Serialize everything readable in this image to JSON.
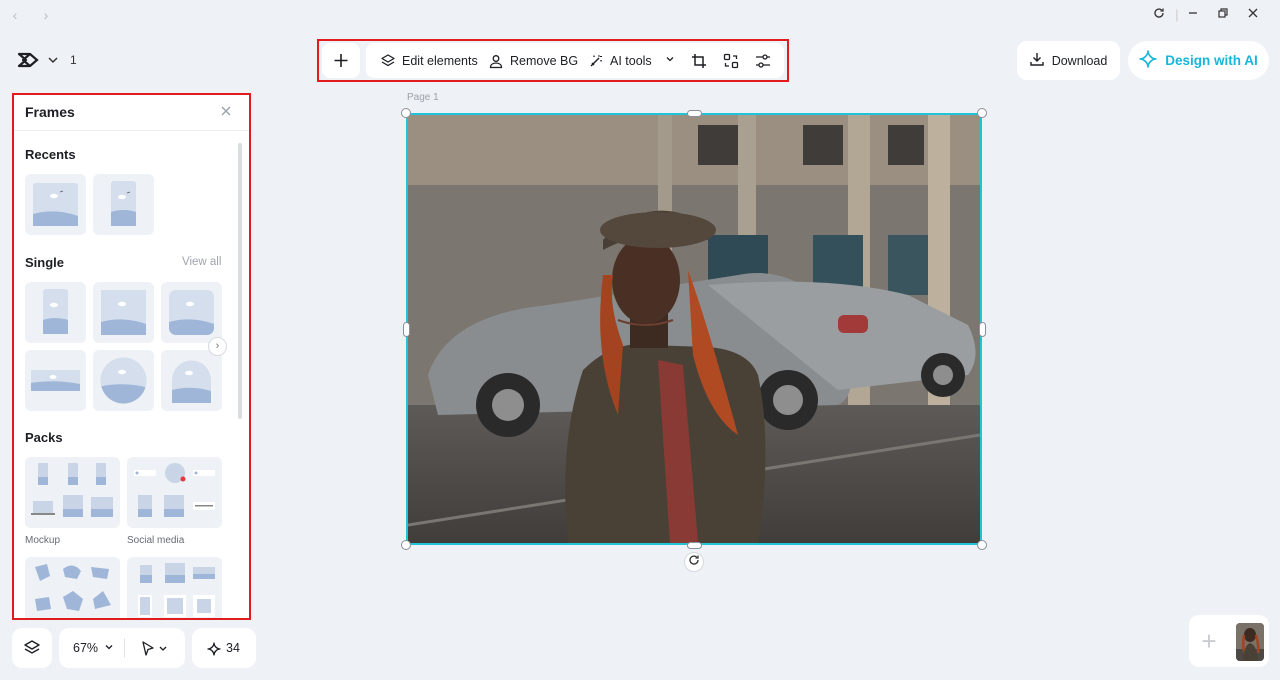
{
  "app": {
    "project_count": "1"
  },
  "toolbar": {
    "add_label": "+",
    "edit_elements": "Edit elements",
    "remove_bg": "Remove BG",
    "ai_tools": "AI tools"
  },
  "header": {
    "download": "Download",
    "design_ai": "Design with AI"
  },
  "frames_panel": {
    "title": "Frames",
    "recents_title": "Recents",
    "single_title": "Single",
    "view_all": "View all",
    "packs_title": "Packs",
    "packs": [
      {
        "label": "Mockup"
      },
      {
        "label": "Social media"
      }
    ]
  },
  "canvas": {
    "page_label": "Page 1"
  },
  "bottom": {
    "zoom": "67%",
    "credits": "34"
  },
  "colors": {
    "accent": "#21c3d6",
    "ai_text": "#18b6d8",
    "highlight": "#e01c1c"
  }
}
